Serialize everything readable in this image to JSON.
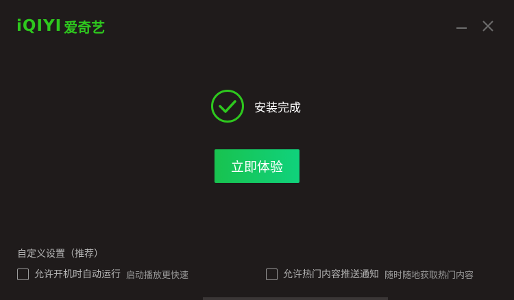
{
  "brand": {
    "logo_latin": "iQIYI",
    "logo_cjk": "爱奇艺",
    "color": "#2ec81e"
  },
  "window_controls": {
    "minimize_icon": "minimize-icon",
    "close_icon": "close-icon"
  },
  "status": {
    "icon": "check-circle-icon",
    "text": "安装完成",
    "color": "#2ec81e"
  },
  "primary_action": {
    "label": "立即体验",
    "color_start": "#18c24f",
    "color_end": "#10d27c"
  },
  "settings": {
    "title": "自定义设置（推荐）",
    "options": [
      {
        "label": "允许开机时自动运行",
        "hint": "启动播放更快速",
        "checked": false
      },
      {
        "label": "允许热门内容推送通知",
        "hint": "随时随地获取热门内容",
        "checked": false
      }
    ]
  }
}
